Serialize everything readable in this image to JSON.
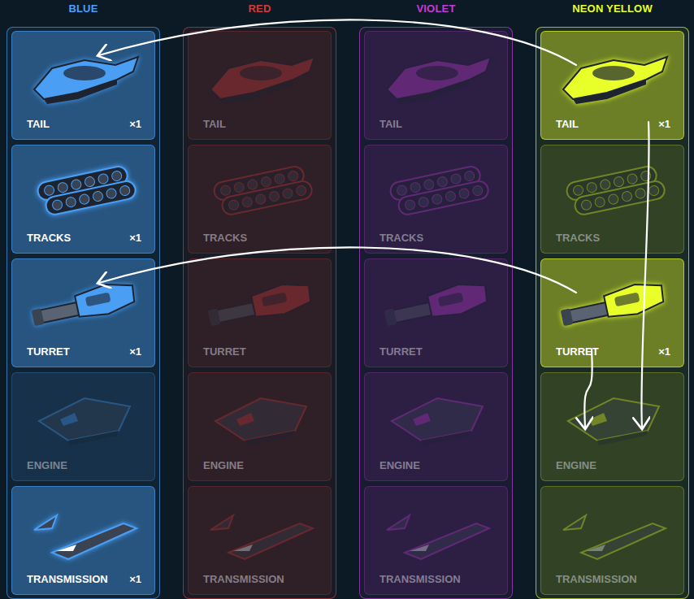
{
  "columns": [
    {
      "name": "BLUE",
      "color": "#4a9ff5",
      "parts": [
        {
          "name": "TAIL",
          "owned": true,
          "count": "×1"
        },
        {
          "name": "TRACKS",
          "owned": true,
          "count": "×1"
        },
        {
          "name": "TURRET",
          "owned": true,
          "count": "×1"
        },
        {
          "name": "ENGINE",
          "owned": false
        },
        {
          "name": "TRANSMISSION",
          "owned": true,
          "count": "×1"
        }
      ]
    },
    {
      "name": "RED",
      "color": "#d23a3a",
      "parts": [
        {
          "name": "TAIL",
          "owned": false
        },
        {
          "name": "TRACKS",
          "owned": false
        },
        {
          "name": "TURRET",
          "owned": false
        },
        {
          "name": "ENGINE",
          "owned": false
        },
        {
          "name": "TRANSMISSION",
          "owned": false
        }
      ]
    },
    {
      "name": "VIOLET",
      "color": "#c43ad6",
      "parts": [
        {
          "name": "TAIL",
          "owned": false
        },
        {
          "name": "TRACKS",
          "owned": false
        },
        {
          "name": "TURRET",
          "owned": false
        },
        {
          "name": "ENGINE",
          "owned": false
        },
        {
          "name": "TRANSMISSION",
          "owned": false
        }
      ]
    },
    {
      "name": "NEON YELLOW",
      "color": "#e8ff2a",
      "parts": [
        {
          "name": "TAIL",
          "owned": true,
          "count": "×1"
        },
        {
          "name": "TRACKS",
          "owned": false
        },
        {
          "name": "TURRET",
          "owned": true,
          "count": "×1"
        },
        {
          "name": "ENGINE",
          "owned": false
        },
        {
          "name": "TRANSMISSION",
          "owned": false
        }
      ]
    }
  ],
  "arrows": [
    {
      "from": {
        "column": "NEON YELLOW",
        "part": "TAIL"
      },
      "to": {
        "column": "BLUE",
        "part": "TAIL"
      }
    },
    {
      "from": {
        "column": "NEON YELLOW",
        "part": "TURRET"
      },
      "to": {
        "column": "BLUE",
        "part": "TURRET"
      }
    },
    {
      "from": {
        "column": "NEON YELLOW",
        "part": "TAIL"
      },
      "to": {
        "column": "NEON YELLOW",
        "part": "ENGINE"
      }
    },
    {
      "from": {
        "column": "NEON YELLOW",
        "part": "TURRET"
      },
      "to": {
        "column": "NEON YELLOW",
        "part": "ENGINE"
      }
    }
  ]
}
